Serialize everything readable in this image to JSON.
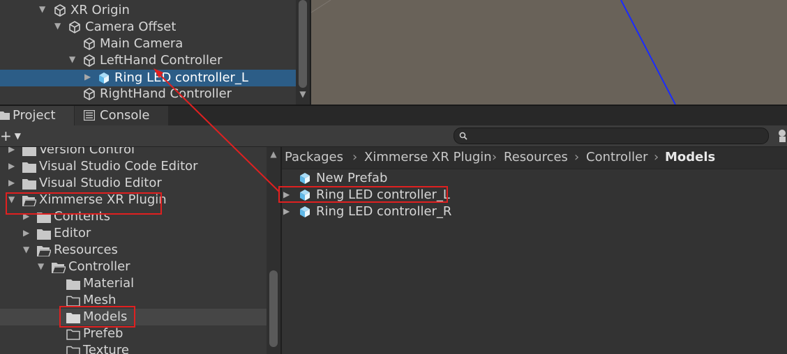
{
  "hierarchy": {
    "items": [
      {
        "label": "XR Origin"
      },
      {
        "label": "Camera Offset"
      },
      {
        "label": "Main Camera"
      },
      {
        "label": "LeftHand Controller"
      },
      {
        "label": "Ring LED controller_L"
      },
      {
        "label": "RightHand Controller"
      }
    ]
  },
  "tabs": {
    "project": "Project",
    "console": "Console"
  },
  "toolbar": {
    "add_label": "+",
    "search_placeholder": ""
  },
  "tree": {
    "items": [
      {
        "label": "Version Control"
      },
      {
        "label": "Visual Studio Code Editor"
      },
      {
        "label": "Visual Studio Editor"
      },
      {
        "label": "Ximmerse XR Plugin"
      },
      {
        "label": "Contents"
      },
      {
        "label": "Editor"
      },
      {
        "label": "Resources"
      },
      {
        "label": "Controller"
      },
      {
        "label": "Material"
      },
      {
        "label": "Mesh"
      },
      {
        "label": "Models"
      },
      {
        "label": "Prefeb"
      },
      {
        "label": "Texture"
      }
    ]
  },
  "breadcrumb": [
    "Packages",
    "Ximmerse XR Plugin",
    "Resources",
    "Controller",
    "Models"
  ],
  "assets": {
    "items": [
      {
        "label": "New Prefab"
      },
      {
        "label": "Ring LED controller_L"
      },
      {
        "label": "Ring LED controller_R"
      }
    ]
  },
  "colors": {
    "selection": "#2c5d87",
    "highlight": "#e02020",
    "prefab_blue": "#5fb8e8",
    "scene_bg": "#696259"
  }
}
